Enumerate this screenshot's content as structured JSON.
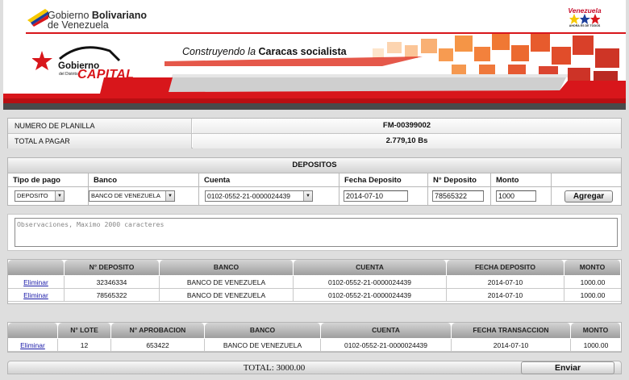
{
  "header": {
    "gov_line1_prefix": "Gobierno ",
    "gov_line1_bold": "Bolivariano",
    "gov_line2": "de Venezuela",
    "country_brand": "Venezuela",
    "country_brand_sub": "AHORA ES DE TODOS",
    "capital_gobierno": "Gobierno",
    "capital_distrito": "del Distrito",
    "capital_capital": "CAPITAL",
    "slogan_prefix": "Construyendo la ",
    "slogan_bold": "Caracas socialista"
  },
  "summary": {
    "rows": [
      {
        "label": "NUMERO DE PLANILLA",
        "value": "FM-00399002"
      },
      {
        "label": "TOTAL A PAGAR",
        "value": "2.779,10 Bs"
      }
    ]
  },
  "depositos": {
    "title": "DEPOSITOS",
    "labels": {
      "tipo": "Tipo de pago",
      "banco": "Banco",
      "cuenta": "Cuenta",
      "fecha": "Fecha Deposito",
      "numero": "N° Deposito",
      "monto": "Monto"
    },
    "values": {
      "tipo": "DEPOSITO",
      "banco": "BANCO DE VENEZUELA",
      "cuenta": "0102-0552-21-0000024439",
      "fecha": "2014-07-10",
      "numero": "78565322",
      "monto": "1000"
    },
    "add_button": "Agregar"
  },
  "observaciones": {
    "placeholder": "Observaciones, Maximo 2000 caracteres"
  },
  "deposit_table": {
    "headers": [
      "",
      "N° DEPOSITO",
      "BANCO",
      "CUENTA",
      "FECHA DEPOSITO",
      "MONTO"
    ],
    "rows": [
      {
        "action": "Eliminar",
        "numero": "32346334",
        "banco": "BANCO DE VENEZUELA",
        "cuenta": "0102-0552-21-0000024439",
        "fecha": "2014-07-10",
        "monto": "1000.00"
      },
      {
        "action": "Eliminar",
        "numero": "78565322",
        "banco": "BANCO DE VENEZUELA",
        "cuenta": "0102-0552-21-0000024439",
        "fecha": "2014-07-10",
        "monto": "1000.00"
      }
    ]
  },
  "transaction_table": {
    "headers": [
      "",
      "N° LOTE",
      "N° APROBACION",
      "BANCO",
      "CUENTA",
      "FECHA TRANSACCION",
      "MONTO"
    ],
    "rows": [
      {
        "action": "Eliminar",
        "lote": "12",
        "aprobacion": "653422",
        "banco": "BANCO DE VENEZUELA",
        "cuenta": "0102-0552-21-0000024439",
        "fecha": "2014-07-10",
        "monto": "1000.00"
      }
    ]
  },
  "footer": {
    "total": "TOTAL: 3000.00",
    "send_button": "Enviar"
  },
  "colors": {
    "brand_red": "#d8161b",
    "link_blue": "#1a1aa8"
  }
}
